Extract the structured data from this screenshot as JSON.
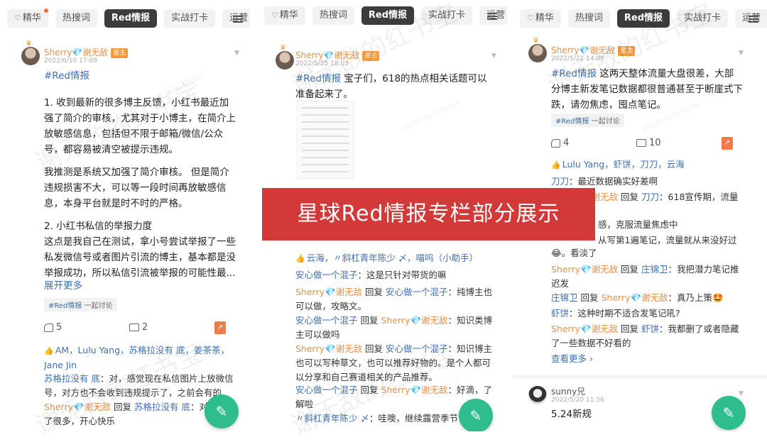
{
  "tabs": {
    "jinghua": "精华",
    "resou": "热搜词",
    "red": "Red情报",
    "shizhan": "实战打卡",
    "yunying": "运营"
  },
  "watermark": {
    "text": "谢无敌的红书宝",
    "id": "5828615421486854"
  },
  "p1": {
    "user": "Sherry💎谢无敌",
    "badge": "星主",
    "date": "2022/6/10 17:09",
    "tag": "#Red情报",
    "para1": "1. 收到最新的很多博主反馈，小红书最近加强了简介的审核，尤其对于小博主，在简介上放敏感信息，包括但不限于邮箱/微信/公众号，都容易被清空被提示违规。",
    "para2": "我推测是系统又加强了简介审核。 但是简介违规损害不大，可以等一段时间再放敏感信息，本身平台就是时不时的严格。",
    "para3": "2. 小红书私信的举报力度\n这点是我自己在测试，拿小号尝试举报了一些私发微信号或者图片引流的博主，基本都是没举报成功，所以私信引流被举报的可能性最...",
    "expand": "展开更多",
    "chip_tag": "#Red情报",
    "chip_action": "一起讨论",
    "likes": "5",
    "comments": "2",
    "liked_by": "AM，Lulu Yang，苏格拉没有 底，姜茶茶，Jane Jin",
    "c1_name": "苏格拉没有 底",
    "c1_text": "：对，感觉现在私信图片上放微信号，对方也不会收到违规提示了，之前会有的",
    "c2_name": "Sherry💎谢无敌",
    "c2_mid": " 回复 ",
    "c2_to": "苏格拉没有 底",
    "c2_text": "：对，放松了很多，开心快乐"
  },
  "p2": {
    "user": "Sherry💎谢无敌",
    "badge": "星主",
    "date": "2022/5/25 18:03",
    "tag": "#Red情报",
    "text": " 宝子们，618的热点相关话题可以准备起来了。",
    "liked_by": "云海，〃斜杠青年陈少 〆，喵呜（小助手）",
    "c1_name": "安心做一个混子",
    "c1_text": "：这是只针对带货的嘛",
    "c2_name": "Sherry💎谢无敌",
    "c2_mid": " 回复 ",
    "c2_to": "安心做一个混子",
    "c2_text": "：纯博主也可以做，攻略文。",
    "c3_name": "安心做一个混子",
    "c3_mid": " 回复 ",
    "c3_to": "Sherry💎谢无敌",
    "c3_text": "：知识类博主可以做吗",
    "c4_name": "Sherry💎谢无敌",
    "c4_mid": " 回复 ",
    "c4_to": "安心做一个混子",
    "c4_text": "：知识博主也可以写种草文，也可以推荐好物的。是个人都可以分享和自己赛道相关的产品推荐。",
    "c5_name": "安心做一个混子",
    "c5_mid": " 回复 ",
    "c5_to": "Sherry💎谢无敌",
    "c5_text": "：好滴，了解啦",
    "c6_name": "〃斜杠青年陈少 〆",
    "c6_text": "：哇噢，继续露营季节"
  },
  "p3": {
    "user": "Sherry💎谢无敌",
    "badge": "星主",
    "date": "2022/5/22 14:09",
    "tag": "#Red情报",
    "text": " 这两天整体流量大盘很差，大部分博主新发笔记数据都很普通甚至于断崖式下跌，请勿焦虑，囤点笔记。",
    "chip_tag": "#Red情报",
    "chip_action": "一起讨论",
    "likes": "4",
    "comments": "10",
    "liked_by": "Lulu Yang，虾饼，刀刀，云海",
    "c1_name": "刀刀",
    "c1_text": "：最近数据确实好差啊",
    "c2_name": "Sherry💎谢无敌",
    "c2_mid": " 回复 ",
    "c2_to": "刀刀",
    "c2_text": "：618宣传期，流量",
    "c3_frag": "感，克服流量焦虑中",
    "c4_frag": "从写第1遍笔记，流量就从来没好过",
    "c4b": "😂。看淡了",
    "c5_name": "Sherry💎谢无敌",
    "c5_mid": " 回复 ",
    "c5_to": "庄锦卫",
    "c5_text": "：我把潜力笔记推迟发",
    "c6_name": "庄锦卫",
    "c6_mid": " 回复 ",
    "c6_to": "Sherry💎谢无敌",
    "c6_text": "：真乃上策🤩",
    "c7_name": "虾饼",
    "c7_text": "：这种时期不适合发笔记吼?",
    "c8_name": "Sherry💎谢无敌",
    "c8_mid": " 回复 ",
    "c8_to": "虾饼",
    "c8_text": "：我都删了或者隐藏了一些数据不好看的",
    "view_more": "查看更多 ›",
    "u2": "sunny兄",
    "u2_date": "2022/5/20 11:56",
    "u2_text": "5.24新规"
  },
  "banner": "星球Red情报专栏部分展示",
  "colors": {
    "accent_red": "#d23a3a",
    "link": "#3f6fb0",
    "owner": "#e9914a",
    "fab": "#2dbd8f",
    "tab_active": "#3c3c3c"
  },
  "icons": {
    "heart": "heart-icon",
    "menu": "menu-icon",
    "like": "thumb-up-icon",
    "comment": "comment-icon",
    "share": "share-icon",
    "edit": "pen-icon"
  }
}
